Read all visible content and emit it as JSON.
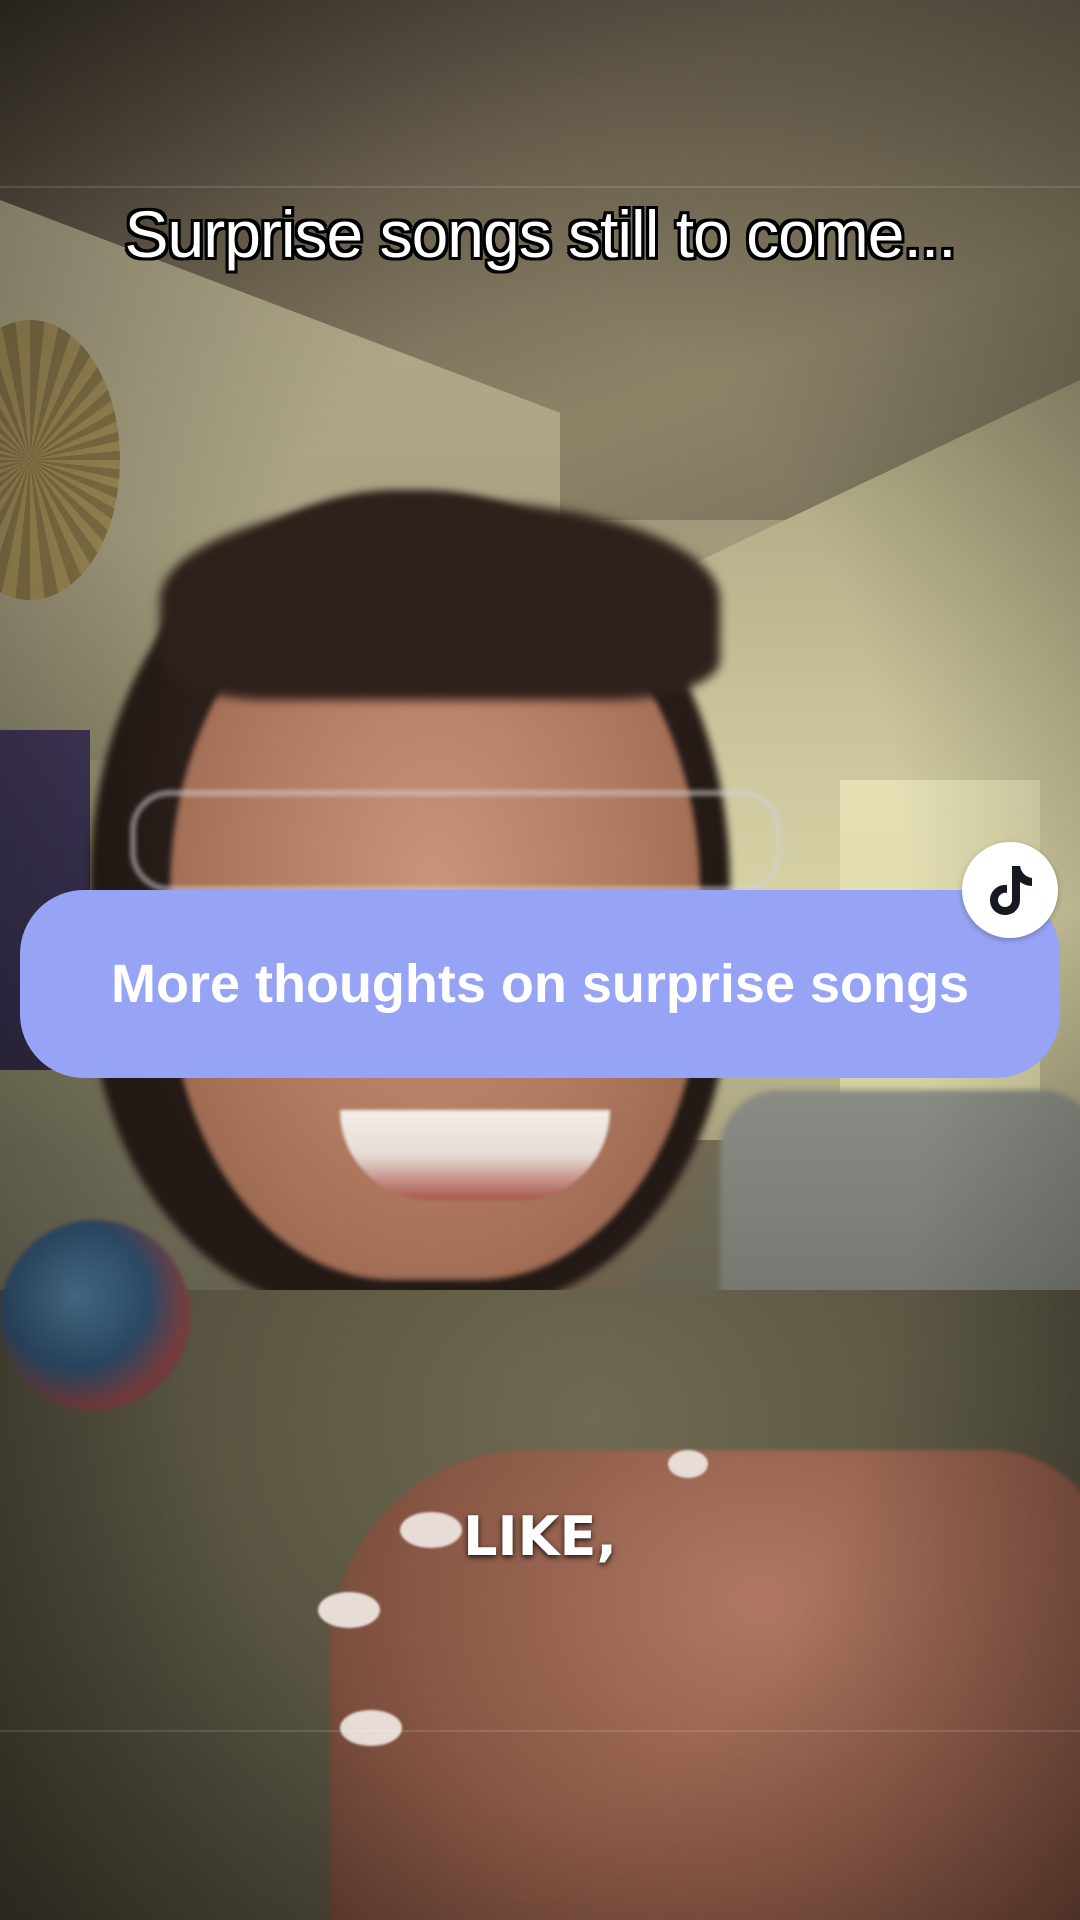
{
  "caption": {
    "top": "Surprise songs still to come..."
  },
  "question_card": {
    "text": "More thoughts on surprise songs",
    "badge_icon": "tiktok-logo-icon",
    "background_color": "#97a3f4"
  },
  "subtitle": {
    "text": "LIKE,"
  }
}
